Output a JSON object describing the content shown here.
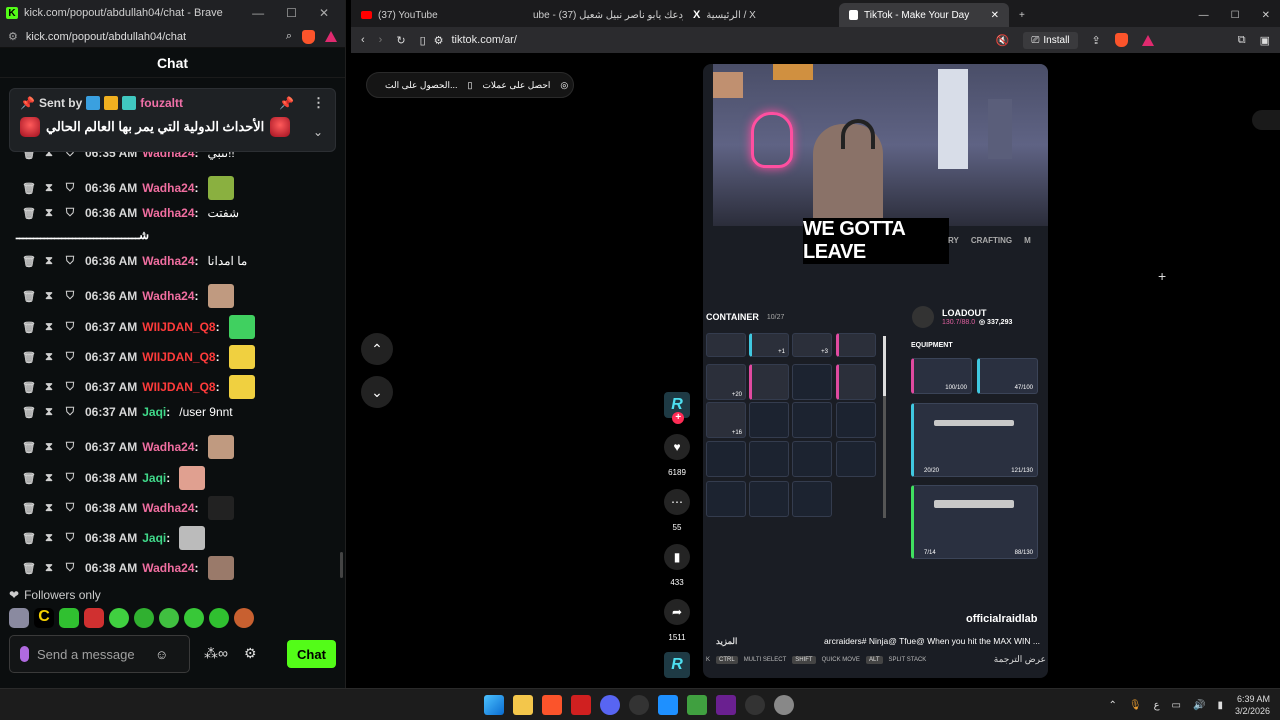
{
  "left_window": {
    "title": "kick.com/popout/abdullah04/chat - Brave",
    "url": "kick.com/popout/abdullah04/chat",
    "chat_title": "Chat",
    "pinned": {
      "sent_by_label": "Sent by",
      "username": "fouzaltt",
      "message": "الأحداث الدولية التي يمر بها العالم الحالي"
    },
    "messages": [
      {
        "time": "06:35 AM",
        "user": "Wadha24",
        "user_class": "u-wadha",
        "text": "نتبي!!",
        "emote": ""
      },
      {
        "time": "06:36 AM",
        "user": "Wadha24",
        "user_class": "u-wadha",
        "text": "",
        "emote": "green"
      },
      {
        "time": "06:36 AM",
        "user": "Wadha24",
        "user_class": "u-wadha",
        "text": "شفتت",
        "emote": ""
      },
      {
        "time": "06:36 AM",
        "user": "Wadha24",
        "user_class": "u-wadha",
        "text": "ما امدانا",
        "emote": ""
      },
      {
        "time": "06:36 AM",
        "user": "Wadha24",
        "user_class": "u-wadha",
        "text": "",
        "emote": "face"
      },
      {
        "time": "06:37 AM",
        "user": "WIIJDAN_Q8",
        "user_class": "u-wiij",
        "text": "",
        "emote": "cat-green"
      },
      {
        "time": "06:37 AM",
        "user": "WIIJDAN_Q8",
        "user_class": "u-wiij",
        "text": "",
        "emote": "cat-yellow"
      },
      {
        "time": "06:37 AM",
        "user": "WIIJDAN_Q8",
        "user_class": "u-wiij",
        "text": "",
        "emote": "cat-yellow"
      },
      {
        "time": "06:37 AM",
        "user": "Jaqi",
        "user_class": "u-jaqi",
        "text": "/user 9nnt",
        "emote": ""
      },
      {
        "time": "06:37 AM",
        "user": "Wadha24",
        "user_class": "u-wadha",
        "text": "",
        "emote": "face"
      },
      {
        "time": "06:38 AM",
        "user": "Jaqi",
        "user_class": "u-jaqi",
        "text": "",
        "emote": "face-pink"
      },
      {
        "time": "06:38 AM",
        "user": "Wadha24",
        "user_class": "u-wadha",
        "text": "",
        "emote": "dark"
      },
      {
        "time": "06:38 AM",
        "user": "Jaqi",
        "user_class": "u-jaqi",
        "text": "",
        "emote": "cat-grey"
      },
      {
        "time": "06:38 AM",
        "user": "Wadha24",
        "user_class": "u-wadha",
        "text": "",
        "emote": "face-dark"
      }
    ],
    "long_line": "شـــــــــــــــــــــــــــــــــــ",
    "followers_only": "Followers only",
    "send_placeholder": "Send a message",
    "chat_button": "Chat"
  },
  "right_window": {
    "tabs": [
      {
        "label": "(37) YouTube",
        "icon": "youtube-icon"
      },
      {
        "label": "ube - تودعك يابو ناصر نبيل شعيل (37)",
        "icon": "youtube-icon"
      },
      {
        "label": "الرئيسية / X",
        "icon": "x-icon"
      },
      {
        "label": "TikTok - Make Your Day",
        "icon": "tiktok-icon",
        "active": true
      }
    ],
    "url": "tiktok.com/ar/",
    "install_label": "Install",
    "get_pill": {
      "left": "احصل على عملات",
      "right": "الحصول على الت..."
    },
    "video": {
      "caption": "WE GOTTA LEAVE",
      "hud_tabs": [
        "RY",
        "CRAFTING",
        "M"
      ],
      "container_label": "CONTAINER",
      "container_count": "10/27",
      "loadout_label": "LOADOUT",
      "loadout_weight": "130.7/88.0",
      "loadout_coins": "337,293",
      "equipment_label": "EQUIPMENT",
      "slot_counts": [
        "+1",
        "+3",
        "+20",
        "+16"
      ],
      "equip_vals": [
        "100/100",
        "47/100"
      ],
      "weapon1_ammo": "20/20",
      "weapon1_total": "121/130",
      "weapon2_ammo": "7/14",
      "weapon2_total": "88/130",
      "watermark": "officialraidlab",
      "description": "arcraiders# Ninja@ Tfue@ When you hit the MAX WIN ...",
      "more_label": "المزيد",
      "hotkeys": [
        {
          "key": "K",
          "label": ""
        },
        {
          "key": "CTRL",
          "label": "MULTI SELECT"
        },
        {
          "key": "SHIFT",
          "label": "QUICK MOVE"
        },
        {
          "key": "ALT",
          "label": "SPLIT STACK"
        }
      ],
      "translate_label": "عرض الترجمة"
    },
    "actions": {
      "likes": "6189",
      "comments": "55",
      "saves": "433",
      "shares": "1511"
    }
  },
  "taskbar": {
    "lang": "ع",
    "time": "6:39 AM",
    "date": "3/2/2026"
  }
}
